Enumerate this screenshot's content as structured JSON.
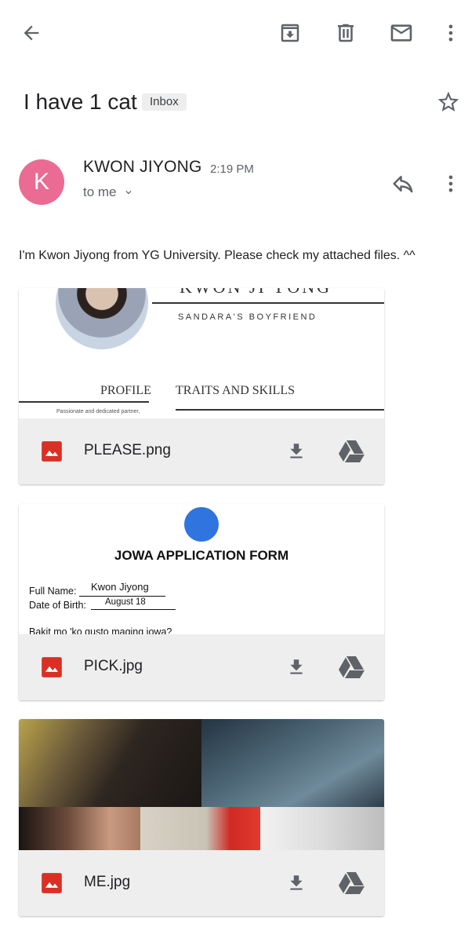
{
  "toolbar": {
    "back_icon": "arrow-left-icon",
    "archive_icon": "archive-icon",
    "delete_icon": "trash-icon",
    "mark_unread_icon": "mail-icon",
    "more_icon": "more-vertical-icon"
  },
  "email": {
    "subject": "I have 1 cat",
    "label": "Inbox",
    "sender_initial": "K",
    "sender_name": "KWON JIYONG",
    "time": "2:19 PM",
    "recipients": "to me",
    "body": "I'm Kwon Jiyong from YG University. Please check my attached files. ^^",
    "avatar_color": "#ea6b93"
  },
  "attachments": [
    {
      "filename": "PLEASE.png",
      "preview": {
        "name_text": "KWON JI YONG",
        "subtitle": "SANDARA'S BOYFRIEND",
        "profile_heading": "PROFILE",
        "traits_heading": "TRAITS AND SKILLS",
        "small_text": "Passionate and dedicated partner,"
      }
    },
    {
      "filename": "PICK.jpg",
      "preview": {
        "title": "JOWA APPLICATION FORM",
        "full_name_label": "Full Name:",
        "full_name_value": "Kwon Jiyong",
        "dob_label": "Date of Birth:",
        "dob_value": "August 18",
        "question": "Bakit mo 'ko gusto maging jowa?"
      }
    },
    {
      "filename": "ME.jpg"
    }
  ],
  "colors": {
    "attachment_bar": "#eeeeee",
    "image_icon": "#d93025",
    "icon_gray": "#5f6368"
  }
}
